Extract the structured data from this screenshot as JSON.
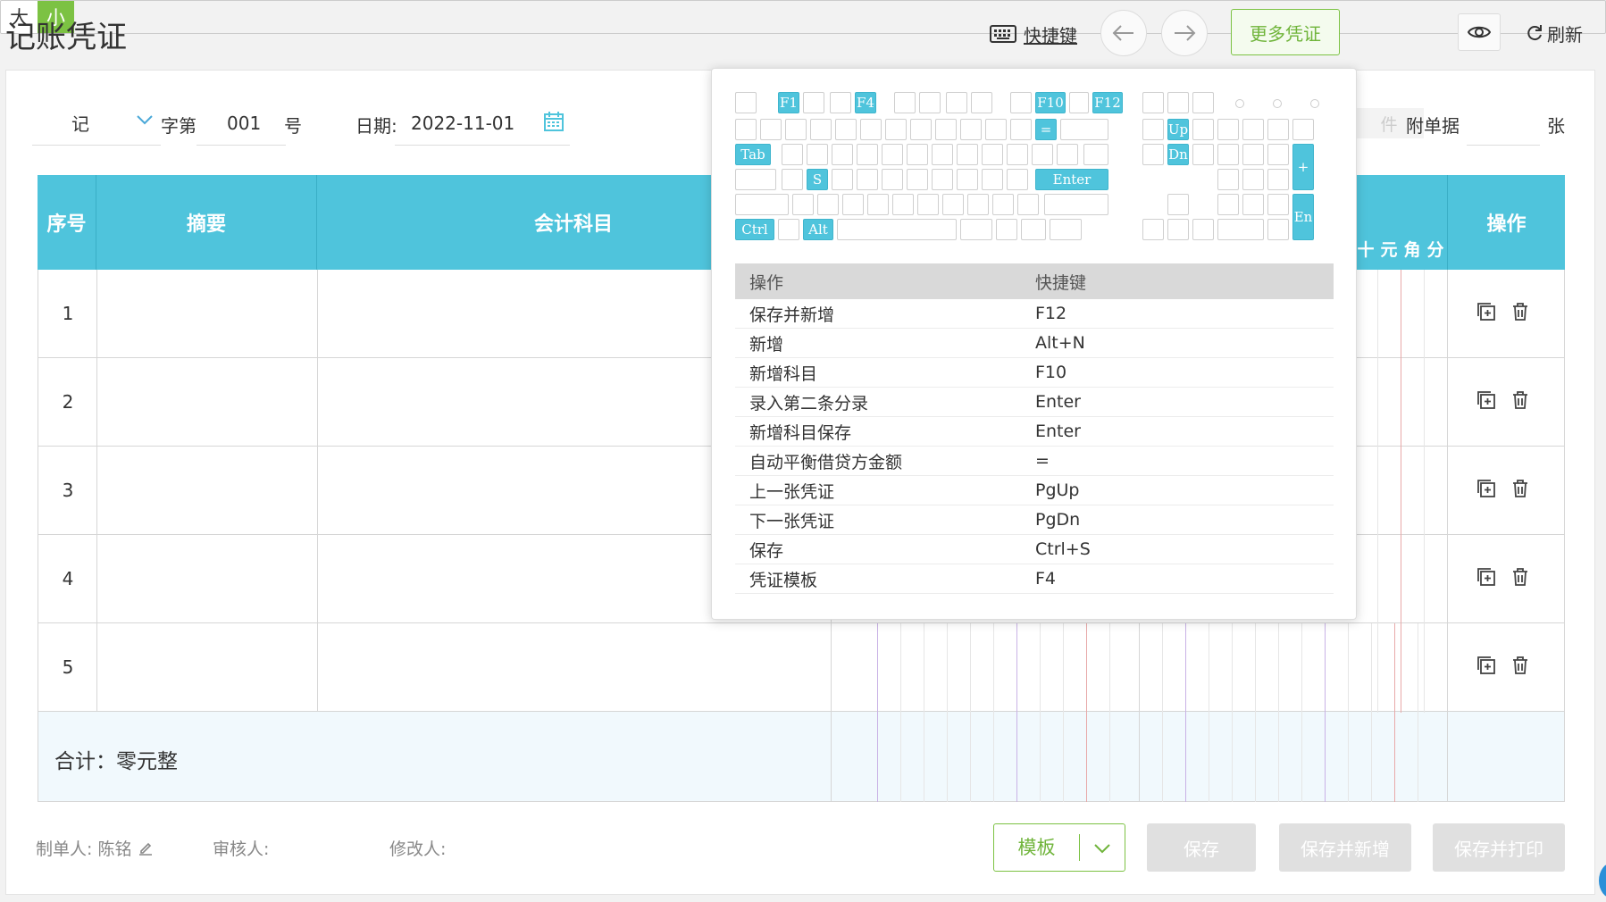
{
  "header": {
    "title": "记账凭证",
    "shortcut_label": "快捷键",
    "prev_icon": "arrow-left-icon",
    "next_icon": "arrow-right-icon",
    "more_vouchers": "更多凭证",
    "size_large": "大",
    "size_small": "小",
    "refresh": "刷新"
  },
  "meta": {
    "voucher_word": "记",
    "zi_label": "字第",
    "number": "001",
    "hao_label": "号",
    "date_label": "日期:",
    "date": "2022-11-01",
    "attach_hint": "件",
    "attach_label": "附单据",
    "zhang_label": "张"
  },
  "table": {
    "headers": {
      "seq": "序号",
      "summary": "摘要",
      "account": "会计科目",
      "ops": "操作"
    },
    "units": [
      "十",
      "元",
      "角",
      "分"
    ],
    "rows": [
      {
        "no": "1"
      },
      {
        "no": "2"
      },
      {
        "no": "3"
      },
      {
        "no": "4"
      },
      {
        "no": "5"
      }
    ],
    "total_label": "合计：零元整"
  },
  "footer": {
    "maker_label": "制单人:",
    "maker": "陈铭",
    "reviewer_label": "审核人:",
    "modifier_label": "修改人:",
    "template": "模板",
    "save": "保存",
    "save_new": "保存并新增",
    "save_print": "保存并打印"
  },
  "shortcuts": {
    "keys": {
      "f1": "F1",
      "f4": "F4",
      "f10": "F10",
      "f12": "F12",
      "eq": "=",
      "up": "Up",
      "dn": "Dn",
      "tab": "Tab",
      "plus": "+",
      "s": "S",
      "enter": "Enter",
      "en": "En",
      "ctrl": "Ctrl",
      "alt": "Alt"
    },
    "col_action": "操作",
    "col_key": "快捷键",
    "rows": [
      {
        "action": "保存并新增",
        "key": "F12"
      },
      {
        "action": "新增",
        "key": "Alt+N"
      },
      {
        "action": "新增科目",
        "key": "F10"
      },
      {
        "action": "录入第二条分录",
        "key": "Enter"
      },
      {
        "action": "新增科目保存",
        "key": "Enter"
      },
      {
        "action": "自动平衡借贷方金额",
        "key": "="
      },
      {
        "action": "上一张凭证",
        "key": "PgUp"
      },
      {
        "action": "下一张凭证",
        "key": "PgDn"
      },
      {
        "action": "保存",
        "key": "Ctrl+S"
      },
      {
        "action": "凭证模板",
        "key": "F4"
      }
    ]
  },
  "colors": {
    "accent": "#4fc4dc",
    "green": "#7cc243",
    "disabled": "#e0e0e0"
  }
}
